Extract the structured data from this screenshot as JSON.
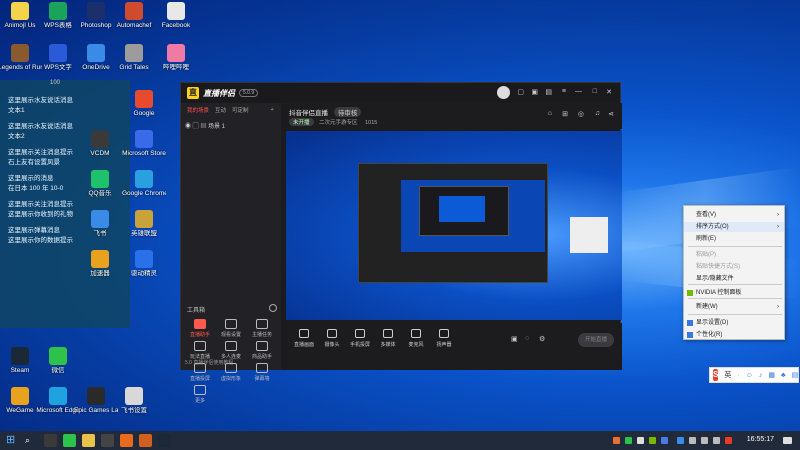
{
  "desktop": {
    "icons": [
      {
        "label": "Animojl Us",
        "color": "#f2d34a"
      },
      {
        "label": "WPS表格",
        "color": "#1aa35a"
      },
      {
        "label": "Photoshop",
        "color": "#1b2f6b"
      },
      {
        "label": "Automachef",
        "color": "#d04a2e"
      },
      {
        "label": "Facebook",
        "color": "#e8e8e8"
      },
      {
        "label": "Legends of Runeterra",
        "color": "#8a5a2e"
      },
      {
        "label": "WPS文字",
        "color": "#2b5ad8"
      },
      {
        "label": "OneDrive",
        "color": "#3a8be8"
      },
      {
        "label": "Grid Tales",
        "color": "#9c9c9c"
      },
      {
        "label": "哔哩哔哩",
        "color": "#f07aa6"
      },
      {
        "label": "Steam",
        "color": "#1b2838"
      },
      {
        "label": "微信",
        "color": "#2dc34a"
      },
      {
        "label": "Microsoft Edge",
        "color": "#1ea2e0"
      },
      {
        "label": "WeGame",
        "color": "#e8a21e"
      },
      {
        "label": "Epic Games Launcher",
        "color": "#2a2a2a"
      },
      {
        "label": "飞书设置",
        "color": "#d8d8d8"
      }
    ],
    "mid_icons": [
      "Google",
      "Microsoft Store",
      "Google Chrome",
      "英雄联盟",
      "驱动精灵",
      "VCDM",
      "QQ音乐",
      "飞书",
      "加速器"
    ]
  },
  "side_panel": {
    "badge": "100",
    "rows": [
      "这里展示水友说话消息",
      "文本1",
      "这里展示水友说话消息",
      "文本2",
      "这里展示关注消息提示",
      "石上友有设置风景",
      "这里展示的消息",
      "在日本 100 年 10-0",
      "这里展示关注消息提示",
      "这里展示你收到的礼物",
      "这里展示弹幕消息",
      "这里展示你的数据提示"
    ]
  },
  "app": {
    "title": "直播伴侣",
    "version": "5.0.9",
    "tabs": [
      "我的场景",
      "互动",
      "可定制"
    ],
    "scene_name": "场景 1",
    "tools_title": "工具箱",
    "tools": [
      {
        "label": "直播助手",
        "accent": true
      },
      {
        "label": "观看设置",
        "accent": false
      },
      {
        "label": "主播任务",
        "accent": false
      },
      {
        "label": "玩法直播",
        "accent": false
      },
      {
        "label": "多人连麦",
        "accent": false
      },
      {
        "label": "商品助手",
        "accent": false
      },
      {
        "label": "直播投屏",
        "accent": false
      },
      {
        "label": "虚拟形象",
        "accent": false
      },
      {
        "label": "弹幕墙",
        "accent": false
      },
      {
        "label": "更多",
        "accent": false
      }
    ],
    "footer": "5.0 直播伴侣使用教程",
    "stream_title": "抖音伴侣直播",
    "status_pill": "待审核",
    "stream_meta": [
      "未开播",
      "二次元手游专区",
      "1015"
    ],
    "bottom_buttons": [
      "直播画面",
      "摄像头",
      "手机投屏",
      "多媒体",
      "麦克风",
      "扬声器"
    ],
    "start_live": "开始直播"
  },
  "context_menu": {
    "items": [
      {
        "label": "查看(V)",
        "disabled": false,
        "arrow": true
      },
      {
        "label": "排序方式(O)",
        "disabled": false,
        "arrow": true
      },
      {
        "label": "刷新(E)",
        "disabled": false,
        "arrow": false
      },
      {
        "label": "粘贴(P)",
        "disabled": true,
        "arrow": false
      },
      {
        "label": "粘贴快捷方式(S)",
        "disabled": true,
        "arrow": false
      },
      {
        "label": "显示/隐藏文件",
        "disabled": false,
        "arrow": false
      },
      {
        "label": "NVIDIA 控制面板",
        "disabled": false,
        "arrow": false
      },
      {
        "label": "新建(W)",
        "disabled": false,
        "arrow": true
      },
      {
        "label": "显示设置(D)",
        "disabled": false,
        "arrow": false
      },
      {
        "label": "个性化(R)",
        "disabled": false,
        "arrow": false
      }
    ]
  },
  "ime": {
    "mode": "英"
  },
  "taskbar": {
    "time": "16:55:17"
  }
}
